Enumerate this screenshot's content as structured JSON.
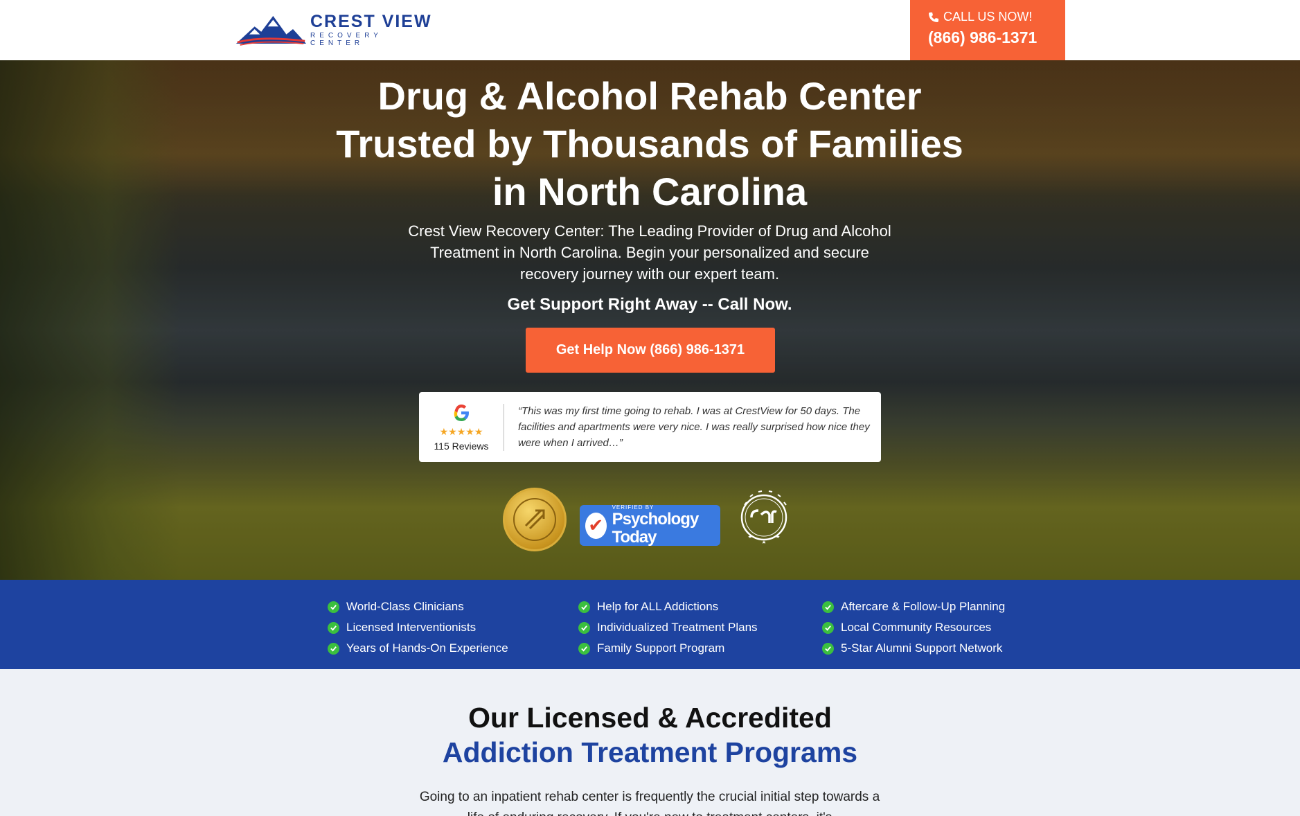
{
  "header": {
    "logo_name": "CREST VIEW",
    "logo_sub": "RECOVERY CENTER",
    "call_label": "CALL US NOW!",
    "call_number": "(866) 986-1371"
  },
  "hero": {
    "title_line1": "Drug & Alcohol Rehab Center",
    "title_line2": "Trusted by Thousands of Families",
    "title_line3": "in North Carolina",
    "subtitle": "Crest View Recovery Center: The Leading Provider of Drug and Alcohol Treatment in North Carolina. Begin your personalized and secure recovery journey with our expert team.",
    "cta_text": "Get Support Right Away -- Call Now.",
    "cta_button": "Get Help Now (866) 986-1371"
  },
  "review": {
    "stars": "★★★★★",
    "count": "115 Reviews",
    "quote": "“This was my first time going to rehab. I was at CrestView for 50 days. The facilities and apartments were very nice. I was really surprised how nice they were when I arrived…”"
  },
  "badges": {
    "pt_small": "VERIFIED BY",
    "pt_big": "Psychology Today"
  },
  "features": {
    "col1": [
      "World-Class Clinicians",
      "Licensed Interventionists",
      "Years of Hands-On Experience"
    ],
    "col2": [
      "Help for ALL Addictions",
      "Individualized Treatment Plans",
      "Family Support Program"
    ],
    "col3": [
      "Aftercare & Follow-Up Planning",
      "Local Community Resources",
      "5-Star Alumni Support Network"
    ]
  },
  "programs": {
    "title_line1": "Our Licensed & Accredited",
    "title_line2": "Addiction Treatment Programs",
    "body": "Going to an inpatient rehab center is frequently the crucial initial step towards a life of enduring recovery. If you're new to treatment centers, it's"
  },
  "colors": {
    "accent_orange": "#f76236",
    "brand_blue": "#1e43a0",
    "check_green": "#3bbf3f"
  }
}
